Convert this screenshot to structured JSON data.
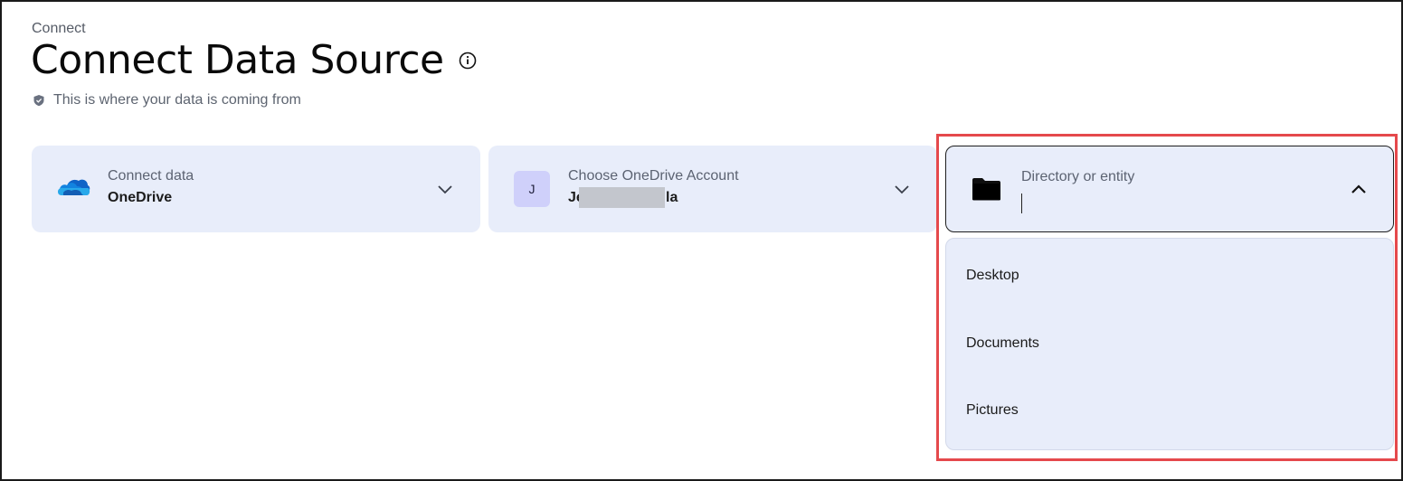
{
  "header": {
    "breadcrumb": "Connect",
    "title": "Connect Data Source",
    "subtitle": "This is where your data is coming from"
  },
  "cards": {
    "source": {
      "label": "Connect data",
      "value": "OneDrive",
      "icon": "onedrive-cloud-icon"
    },
    "account": {
      "label": "Choose OneDrive Account",
      "avatar_initial": "J",
      "value_start": "Je",
      "value_end": "la"
    },
    "directory": {
      "label": "Directory or entity",
      "value": "",
      "icon": "folder-icon",
      "expanded": true
    }
  },
  "dropdown": {
    "options": [
      "Desktop",
      "Documents",
      "Pictures"
    ]
  },
  "colors": {
    "card_bg": "#e8edfa",
    "highlight": "#e5494c",
    "avatar_bg": "#cfd0fa"
  }
}
